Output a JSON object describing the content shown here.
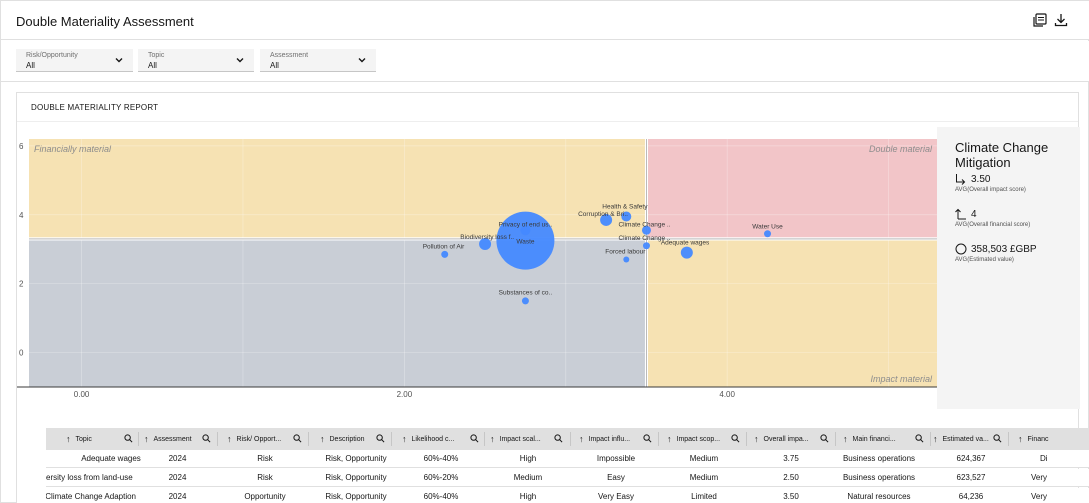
{
  "header": {
    "title": "Double Materiality Assessment"
  },
  "filters": [
    {
      "label": "Risk/Opportunity",
      "value": "All"
    },
    {
      "label": "Topic",
      "value": "All"
    },
    {
      "label": "Assessment",
      "value": "All"
    }
  ],
  "report": {
    "title": "DOUBLE MATERIALITY REPORT"
  },
  "chart_data": {
    "type": "scatter",
    "xlim": [
      -0.4,
      5.3
    ],
    "ylim": [
      -1.0,
      6.2
    ],
    "x_ticks": [
      0,
      2,
      4
    ],
    "x_tick_labels": [
      "0.00",
      "2.00",
      "4.00"
    ],
    "y_ticks": [
      0,
      2,
      4,
      6
    ],
    "y_tick_labels": [
      "0",
      "2",
      "4",
      "6"
    ],
    "avg_x": 3.5,
    "avg_y": 3.3,
    "quadrants": {
      "top_left": {
        "label": "Financially material",
        "color": "#f6e2b3"
      },
      "top_right": {
        "label": "Double material",
        "color": "#f2c5c8"
      },
      "bottom_left": {
        "label": "",
        "color": "#c9ced6"
      },
      "bottom_right": {
        "label": "Impact material",
        "color": "#f6e2b3"
      }
    },
    "point_color": "#4589ff",
    "points": [
      {
        "label": "Waste",
        "x": 2.75,
        "y": 3.25,
        "size": 29
      },
      {
        "label": "Privacy of end us..",
        "x": 2.75,
        "y": 3.55,
        "size": 5
      },
      {
        "label": "Biodiversity loss f..",
        "x": 2.5,
        "y": 3.15,
        "size": 6
      },
      {
        "label": "Pollution of Air",
        "x": 2.25,
        "y": 2.85,
        "size": 3.5
      },
      {
        "label": "Substances of co..",
        "x": 2.75,
        "y": 1.5,
        "size": 3.5
      },
      {
        "label": "Corruption & Bri..",
        "x": 3.25,
        "y": 3.85,
        "size": 6
      },
      {
        "label": "Health & Safety",
        "x": 3.375,
        "y": 3.95,
        "size": 5
      },
      {
        "label": "Climate Change ..",
        "x": 3.5,
        "y": 3.55,
        "size": 4.5
      },
      {
        "label": "Climate Change ..",
        "x": 3.5,
        "y": 3.1,
        "size": 3.5
      },
      {
        "label": "Forced labour",
        "x": 3.375,
        "y": 2.7,
        "size": 3
      },
      {
        "label": "Adequate wages",
        "x": 3.75,
        "y": 2.9,
        "size": 6
      },
      {
        "label": "Water Use",
        "x": 4.25,
        "y": 3.45,
        "size": 3.5
      }
    ]
  },
  "summary": {
    "title": "Climate Change Mitigation",
    "impact_value": "3.50",
    "impact_label": "AVG(Overall impact score)",
    "financial_value": "4",
    "financial_label": "AVG(Overall financial score)",
    "estimated_value": "358,503 £GBP",
    "estimated_label": "AVG(Estimated value)"
  },
  "table": {
    "columns": [
      "Topic",
      "Assessment",
      "Risk/ Opport...",
      "Description",
      "Likelihood c...",
      "Impact scal...",
      "Impact influ...",
      "Impact scop...",
      "Overall impa...",
      "Main financi...",
      "Estimated va...",
      "Financ"
    ],
    "rows": [
      [
        "Adequate wages",
        "2024",
        "Risk",
        "Risk, Opportunity",
        "60%-40%",
        "High",
        "Impossible",
        "Medium",
        "3.75",
        "Business operations",
        "624,367",
        "Di"
      ],
      [
        "ersity loss from land-use",
        "2024",
        "Risk",
        "Risk, Opportunity",
        "60%-20%",
        "Medium",
        "Easy",
        "Medium",
        "2.50",
        "Business operations",
        "623,527",
        "Very"
      ],
      [
        "Climate Change Adaption",
        "2024",
        "Opportunity",
        "Risk, Opportunity",
        "60%-40%",
        "High",
        "Very Easy",
        "Limited",
        "3.50",
        "Natural resources",
        "64,236",
        "Very"
      ]
    ]
  }
}
